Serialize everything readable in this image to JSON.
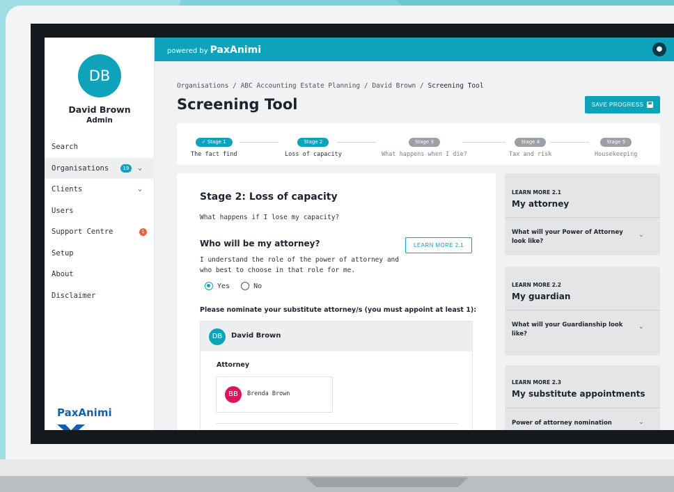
{
  "user": {
    "initials": "DB",
    "name": "David Brown",
    "role": "Admin"
  },
  "nav": [
    {
      "label": "Search"
    },
    {
      "label": "Organisations",
      "badge": "19",
      "chevron": "chevron-down-icon"
    },
    {
      "label": "Clients",
      "chevron": "chevron-down-icon"
    },
    {
      "label": "Users"
    },
    {
      "label": "Support Centre",
      "badge": "1"
    },
    {
      "label": "Setup"
    },
    {
      "label": "About"
    },
    {
      "label": "Disclaimer"
    }
  ],
  "brand": {
    "powered_by": "powered by",
    "name": "PaxAnimi",
    "footer_logo": "PaxAnimi"
  },
  "breadcrumb": {
    "items": [
      "Organisations",
      "ABC Accounting Estate Planning",
      "David Brown"
    ],
    "current": "Screening Tool",
    "sep": "/"
  },
  "page": {
    "title": "Screening Tool",
    "save_label": "SAVE PROGRESS"
  },
  "stepper": [
    {
      "pill": "✓ Stage 1",
      "label": "The fact find",
      "state": "done"
    },
    {
      "pill": "Stage 2",
      "label": "Loss of capacity",
      "state": "current"
    },
    {
      "pill": "Stage 3",
      "label": "What happens when I die?",
      "state": "todo"
    },
    {
      "pill": "Stage 4",
      "label": "Tax and risk",
      "state": "todo"
    },
    {
      "pill": "Stage 5",
      "label": "Housekeeping",
      "state": "todo"
    }
  ],
  "content": {
    "stage_title": "Stage 2: Loss of capacity",
    "stage_sub": "What happens if I lose my capacity?",
    "question": "Who will be my attorney?",
    "learn_more_btn": "LEARN MORE 2.1",
    "question_text": "I understand the role of the power of attorney and who best to choose in that role for me.",
    "yes": "Yes",
    "no": "No",
    "selected": "Yes",
    "nominate": "Please nominate your substitute attorney/s (you must appoint at least 1):",
    "nominee": {
      "initials": "DB",
      "name": "David Brown"
    },
    "attorney_label": "Attorney",
    "attorney": {
      "initials": "BB",
      "name": "Brenda Brown"
    }
  },
  "learn_more": [
    {
      "kicker": "LEARN MORE 2.1",
      "title": "My attorney",
      "question": "What will your Power of Attorney look like?"
    },
    {
      "kicker": "LEARN MORE 2.2",
      "title": "My guardian",
      "question": "What will your Guardianship look like?"
    },
    {
      "kicker": "LEARN MORE 2.3",
      "title": "My substitute appointments",
      "question": "Power of attorney nomination"
    }
  ],
  "colors": {
    "accent": "#0fa3bb",
    "alert": "#f0623c",
    "avatar_pink": "#e0145a",
    "brand_blue": "#1560a8"
  }
}
